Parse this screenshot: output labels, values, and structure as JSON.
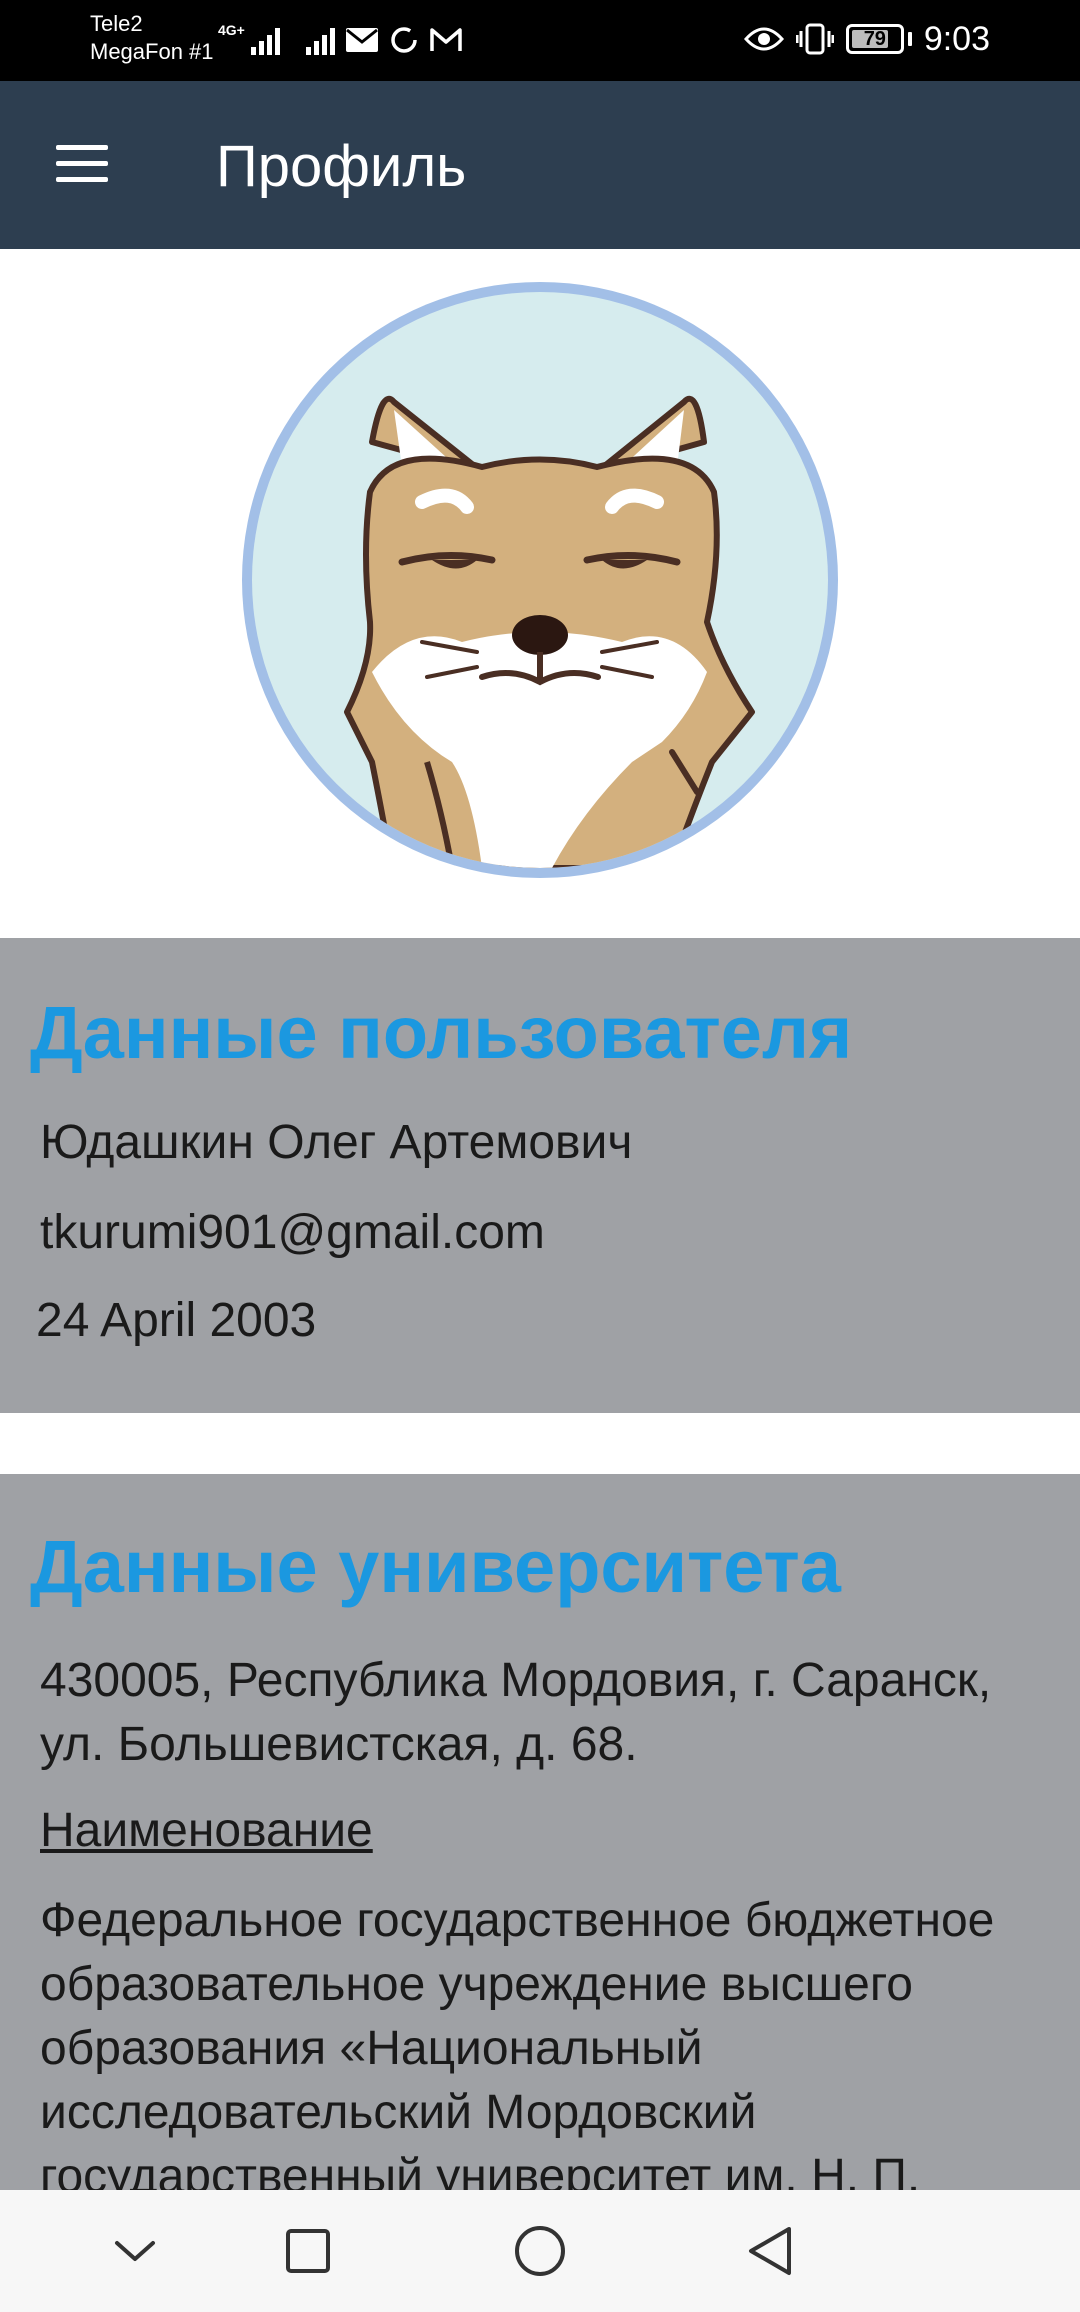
{
  "status_bar": {
    "carrier_1": "Tele2",
    "carrier_2": "MegaFon #1",
    "network_tag": "4G+",
    "battery_level": "79",
    "battery_fraction": 0.79,
    "time": "9:03"
  },
  "app_bar": {
    "title": "Профиль"
  },
  "avatar": {
    "subject": "cartoon shiba dog illustration",
    "ring_color": "#a2bfe7"
  },
  "user_data": {
    "title": "Данные пользователя",
    "full_name": "Юдашкин Олег Артемович",
    "email": "tkurumi901@gmail.com",
    "birth_date": "24 April 2003"
  },
  "university_data": {
    "title": "Данные университета",
    "address": "430005, Республика Мордовия, г. Саранск, ул. Большевистская, д. 68.",
    "name_label": "Наименование",
    "name_value": "Федеральное государственное бюджетное образовательное учреждение высшего образования «Национальный исследовательский Мордовский государственный университет им. Н. П. Огарёва»"
  },
  "colors": {
    "app_bar": "#2d3e50",
    "card_background": "#9fa1a5",
    "section_title": "#1b98e0",
    "nav_bar": "#f7f7f7"
  },
  "icons": {
    "menu": "hamburger-menu-icon",
    "nav_down": "chevron-down-icon",
    "nav_recents": "square-icon",
    "nav_home": "circle-icon",
    "nav_back": "triangle-back-icon"
  }
}
